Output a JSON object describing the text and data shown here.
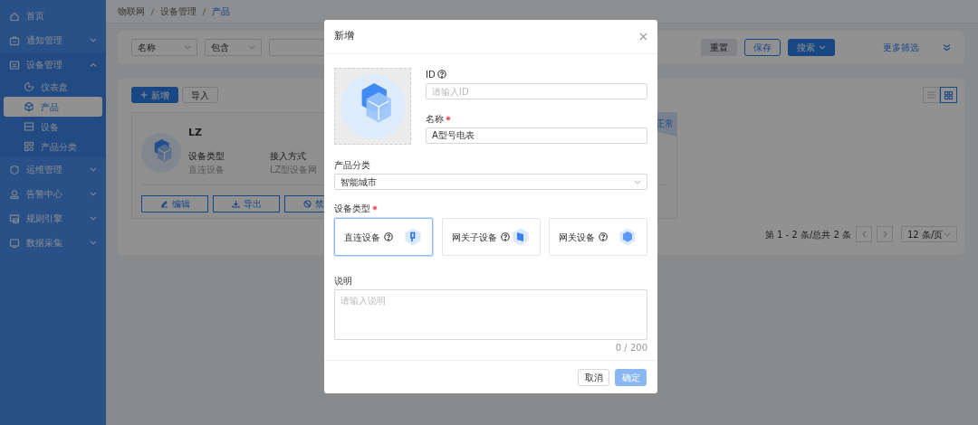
{
  "breadcrumb": [
    {
      "label": "物联网",
      "current": false
    },
    {
      "label": "设备管理",
      "current": false
    },
    {
      "label": "产品",
      "current": true
    }
  ],
  "sidebar": {
    "items": [
      {
        "label": "首页",
        "selected": false
      },
      {
        "label": "通知管理",
        "expanded": false,
        "selected": false
      },
      {
        "label": "设备管理",
        "expanded": true,
        "selected": false,
        "children": [
          {
            "label": "仪表盘",
            "selected": false
          },
          {
            "label": "产品",
            "selected": true
          },
          {
            "label": "设备",
            "selected": false
          },
          {
            "label": "产品分类",
            "selected": false
          }
        ]
      },
      {
        "label": "运维管理",
        "expanded": false,
        "selected": false
      },
      {
        "label": "告警中心",
        "expanded": false,
        "selected": false
      },
      {
        "label": "规则引擎",
        "expanded": false,
        "selected": false
      },
      {
        "label": "数据采集",
        "expanded": false,
        "selected": false
      }
    ]
  },
  "filter": {
    "selects": [
      {
        "value": "名称"
      },
      {
        "value": "包含"
      }
    ],
    "buttons": [
      {
        "label": "重置",
        "kind": "secondary"
      },
      {
        "label": "保存",
        "kind": "outline"
      },
      {
        "label": "搜索",
        "kind": "dropdown"
      }
    ],
    "more_filters": "更多筛选"
  },
  "toolbar": {
    "buttons": [
      {
        "label": "新增",
        "kind": "add"
      },
      {
        "label": "导入",
        "kind": "plain"
      }
    ],
    "view_modes": [
      {
        "selected": false
      },
      {
        "selected": true
      }
    ]
  },
  "product_card": {
    "name": "LZ",
    "status": "正常",
    "fields": [
      {
        "label": "设备类型",
        "value": "直连设备"
      },
      {
        "label": "接入方式",
        "value": "LZ型设备网"
      }
    ],
    "actions": [
      "编辑",
      "导出",
      "禁"
    ]
  },
  "pagination": {
    "summary": "第 1 - 2 条/总共 2 条",
    "page_size": "12 条/页"
  },
  "dialog": {
    "title": "新增",
    "id": {
      "label": "ID",
      "help": true,
      "placeholder": "请输入ID"
    },
    "name": {
      "label": "名称",
      "required": true,
      "value": "A型号电表"
    },
    "category": {
      "label": "产品分类",
      "value": "智能城市"
    },
    "device_type": {
      "label": "设备类型",
      "required": true,
      "options": [
        {
          "label": "直连设备",
          "help": true,
          "selected": true
        },
        {
          "label": "网关子设备",
          "help": true,
          "selected": false
        },
        {
          "label": "网关设备",
          "help": true,
          "selected": false
        }
      ]
    },
    "description": {
      "label": "说明",
      "placeholder": "请输入说明",
      "counter": "0 / 200"
    },
    "buttons": [
      {
        "label": "取消",
        "kind": "default",
        "disabled": false
      },
      {
        "label": "确定",
        "kind": "primary",
        "disabled": true
      }
    ]
  }
}
